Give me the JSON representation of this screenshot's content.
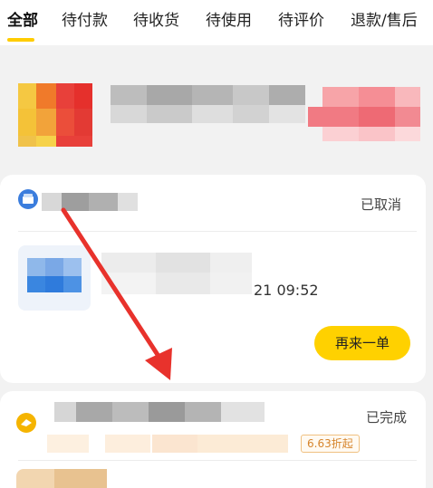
{
  "tabs": [
    {
      "label": "全部",
      "active": true
    },
    {
      "label": "待付款",
      "active": false
    },
    {
      "label": "待收货",
      "active": false
    },
    {
      "label": "待使用",
      "active": false
    },
    {
      "label": "待评价",
      "active": false
    },
    {
      "label": "退款/售后",
      "active": false
    }
  ],
  "orders": [
    {
      "status": "已取消",
      "time_fragment": "21 09:52",
      "reorder_label": "再来一单",
      "shop_icon": "store-icon"
    },
    {
      "status": "已完成",
      "discount_tag": "6.63折起",
      "shop_icon": "store-icon"
    }
  ],
  "colors": {
    "accent": "#ffd100",
    "tab_indicator": "#ffcc00",
    "arrow": "#e8322c"
  }
}
